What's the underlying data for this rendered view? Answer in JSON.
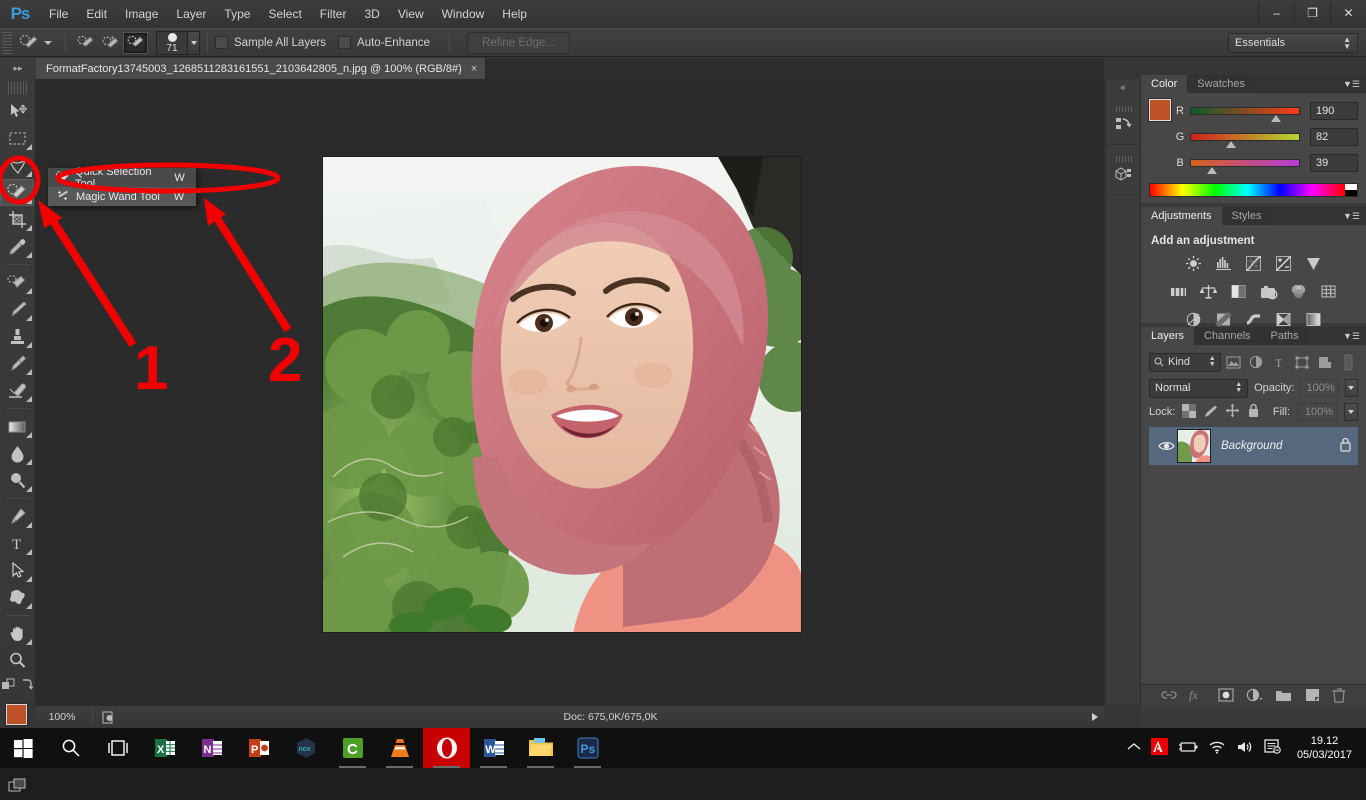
{
  "app": {
    "name": "Ps",
    "logo": "Ps"
  },
  "menubar": {
    "items": [
      "File",
      "Edit",
      "Image",
      "Layer",
      "Type",
      "Select",
      "Filter",
      "3D",
      "View",
      "Window",
      "Help"
    ],
    "window_controls": {
      "minimize": "–",
      "restore": "❐",
      "close": "✕"
    }
  },
  "options_bar": {
    "brush_size": "71",
    "sample_all_layers": "Sample All Layers",
    "auto_enhance": "Auto-Enhance",
    "refine_edge": "Refine Edge...",
    "workspace": "Essentials"
  },
  "document_tab": {
    "title": "FormatFactory13745003_1268511283161551_2103642805_n.jpg @ 100% (RGB/8#)",
    "close": "×"
  },
  "tools": [
    {
      "name": "move-tool",
      "label": "Move Tool"
    },
    {
      "name": "marquee-tool",
      "label": "Rectangular Marquee Tool"
    },
    {
      "name": "lasso-tool",
      "label": "Lasso Tool"
    },
    {
      "name": "quick-selection-tool",
      "label": "Quick Selection Tool",
      "selected": true
    },
    {
      "name": "crop-tool",
      "label": "Crop Tool"
    },
    {
      "name": "eyedropper-tool",
      "label": "Eyedropper Tool"
    },
    {
      "name": "healing-brush-tool",
      "label": "Spot Healing Brush Tool"
    },
    {
      "name": "brush-tool",
      "label": "Brush Tool"
    },
    {
      "name": "clone-stamp-tool",
      "label": "Clone Stamp Tool"
    },
    {
      "name": "history-brush-tool",
      "label": "History Brush Tool"
    },
    {
      "name": "eraser-tool",
      "label": "Eraser Tool"
    },
    {
      "name": "gradient-tool",
      "label": "Gradient Tool"
    },
    {
      "name": "blur-tool",
      "label": "Blur Tool"
    },
    {
      "name": "dodge-tool",
      "label": "Dodge Tool"
    },
    {
      "name": "pen-tool",
      "label": "Pen Tool"
    },
    {
      "name": "type-tool",
      "label": "Horizontal Type Tool"
    },
    {
      "name": "path-selection-tool",
      "label": "Path Selection Tool"
    },
    {
      "name": "shape-tool",
      "label": "Custom Shape Tool"
    },
    {
      "name": "hand-tool",
      "label": "Hand Tool"
    },
    {
      "name": "zoom-tool",
      "label": "Zoom Tool"
    }
  ],
  "tool_flyout": {
    "items": [
      {
        "label": "Quick Selection Tool",
        "key": "W",
        "active": true
      },
      {
        "label": "Magic Wand Tool",
        "key": "W",
        "active": false
      }
    ]
  },
  "annotations": [
    {
      "label": "1"
    },
    {
      "label": "2"
    }
  ],
  "status_bar": {
    "zoom": "100%",
    "doc_info": "Doc: 675,0K/675,0K"
  },
  "color_panel": {
    "tabs": [
      {
        "label": "Color",
        "active": true
      },
      {
        "label": "Swatches",
        "active": false
      }
    ],
    "foreground": "#be5227",
    "background": "#ffffff",
    "channels": [
      {
        "label": "R",
        "value": "190",
        "pos": 74
      },
      {
        "label": "G",
        "value": "82",
        "pos": 32
      },
      {
        "label": "B",
        "value": "39",
        "pos": 15
      }
    ]
  },
  "adjustments_panel": {
    "tabs": [
      {
        "label": "Adjustments",
        "active": true
      },
      {
        "label": "Styles",
        "active": false
      }
    ],
    "title": "Add an adjustment",
    "rows": [
      [
        "brightness-contrast-icon",
        "levels-icon",
        "curves-icon",
        "exposure-icon",
        "vibrance-icon"
      ],
      [
        "hue-saturation-icon",
        "color-balance-icon",
        "black-white-icon",
        "photo-filter-icon",
        "channel-mixer-icon",
        "color-lookup-icon"
      ],
      [
        "invert-icon",
        "posterize-icon",
        "threshold-icon",
        "selective-color-icon",
        "gradient-map-icon"
      ]
    ]
  },
  "layers_panel": {
    "tabs": [
      {
        "label": "Layers",
        "active": true
      },
      {
        "label": "Channels",
        "active": false
      },
      {
        "label": "Paths",
        "active": false
      }
    ],
    "filter_kind": "Kind",
    "blend_mode": "Normal",
    "opacity_label": "Opacity:",
    "opacity_value": "100%",
    "lock_label": "Lock:",
    "fill_label": "Fill:",
    "fill_value": "100%",
    "layers": [
      {
        "name": "Background",
        "locked": true,
        "visible": true
      }
    ],
    "footer_icons": [
      "link-icon",
      "fx-icon",
      "mask-icon",
      "adjustment-icon",
      "folder-icon",
      "new-layer-icon",
      "trash-icon"
    ]
  },
  "icon_dock": {
    "collapse": "«",
    "buttons": [
      "history-icon",
      "3d-icon"
    ]
  },
  "taskbar": {
    "icons": [
      {
        "name": "start-button",
        "label": "⊞"
      },
      {
        "name": "search-icon",
        "label": "⌕"
      },
      {
        "name": "task-view-icon",
        "label": "❐"
      },
      {
        "name": "excel-icon",
        "label": "X"
      },
      {
        "name": "onenote-icon",
        "label": "N"
      },
      {
        "name": "powerpoint-icon",
        "label": "P"
      },
      {
        "name": "nox-icon",
        "label": "nox"
      },
      {
        "name": "c-app-icon",
        "label": "C"
      },
      {
        "name": "vlc-icon",
        "label": "▲"
      },
      {
        "name": "opera-icon",
        "label": "O"
      },
      {
        "name": "word-icon",
        "label": "W"
      },
      {
        "name": "file-explorer-icon",
        "label": "🗀"
      },
      {
        "name": "photoshop-taskbar-icon",
        "label": "Ps"
      }
    ],
    "tray": [
      "show-hidden-icons",
      "adobe-icon",
      "battery-icon",
      "wifi-icon",
      "volume-icon",
      "action-center-icon"
    ],
    "clock_time": "19.12",
    "clock_date": "05/03/2017"
  }
}
